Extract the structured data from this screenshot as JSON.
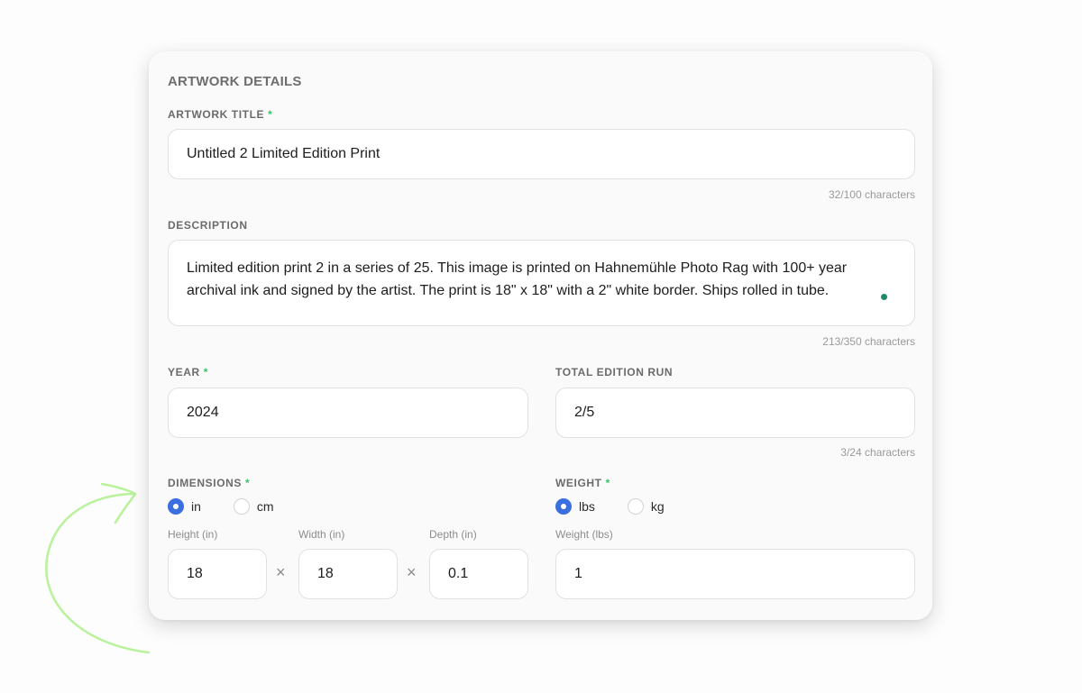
{
  "section": {
    "title": "ARTWORK DETAILS"
  },
  "artwork_title": {
    "label": "ARTWORK TITLE",
    "required_mark": "*",
    "value": "Untitled 2 Limited Edition Print",
    "counter": "32/100 characters"
  },
  "description": {
    "label": "DESCRIPTION",
    "value": "Limited edition print 2 in a series of 25. This image is printed on Hahnemühle Photo Rag with 100+ year archival ink and signed by the artist. The print is 18\" x 18\" with a 2\" white border.  Ships rolled in tube.",
    "counter": "213/350 characters"
  },
  "year": {
    "label": "YEAR",
    "required_mark": "*",
    "value": "2024"
  },
  "edition_run": {
    "label": "TOTAL EDITION RUN",
    "value": "2/5",
    "counter": "3/24 characters"
  },
  "dimensions": {
    "label": "DIMENSIONS",
    "required_mark": "*",
    "units": [
      {
        "label": "in",
        "selected": true
      },
      {
        "label": "cm",
        "selected": false
      }
    ],
    "height": {
      "label": "Height (in)",
      "value": "18"
    },
    "width": {
      "label": "Width (in)",
      "value": "18"
    },
    "depth": {
      "label": "Depth (in)",
      "value": "0.1"
    },
    "separator": "×"
  },
  "weight": {
    "label": "WEIGHT",
    "required_mark": "*",
    "units": [
      {
        "label": "lbs",
        "selected": true
      },
      {
        "label": "kg",
        "selected": false
      }
    ],
    "field": {
      "label": "Weight (lbs)",
      "value": "1"
    }
  },
  "colors": {
    "accent": "#3b6fe0",
    "required": "#35c46a",
    "annotation": "#b9f29a",
    "status_dot": "#1f8a6a"
  }
}
